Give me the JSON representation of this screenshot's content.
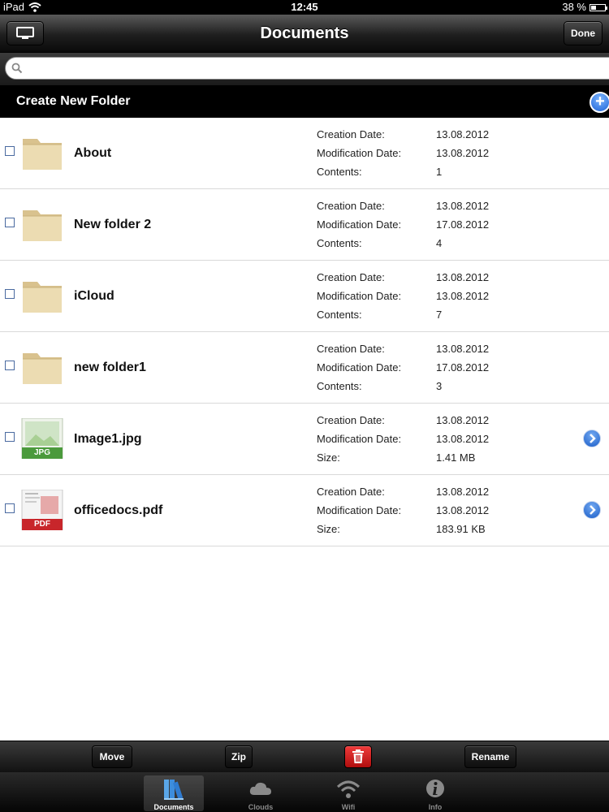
{
  "status_bar": {
    "device": "iPad",
    "time": "12:45",
    "battery": "38 %",
    "battery_level": 0.38
  },
  "nav": {
    "title": "Documents",
    "done_label": "Done"
  },
  "search": {
    "value": "",
    "placeholder": ""
  },
  "create_folder": {
    "label": "Create New Folder"
  },
  "files": [
    {
      "name": "About",
      "kind": "folder",
      "meta": [
        {
          "label": "Creation Date:",
          "value": "13.08.2012"
        },
        {
          "label": "Modification Date:",
          "value": "13.08.2012"
        },
        {
          "label": "Contents:",
          "value": "1"
        }
      ]
    },
    {
      "name": "New folder 2",
      "kind": "folder",
      "meta": [
        {
          "label": "Creation Date:",
          "value": "13.08.2012"
        },
        {
          "label": "Modification Date:",
          "value": "17.08.2012"
        },
        {
          "label": "Contents:",
          "value": "4"
        }
      ]
    },
    {
      "name": "iCloud",
      "kind": "folder",
      "meta": [
        {
          "label": "Creation Date:",
          "value": "13.08.2012"
        },
        {
          "label": "Modification Date:",
          "value": "13.08.2012"
        },
        {
          "label": "Contents:",
          "value": "7"
        }
      ]
    },
    {
      "name": "new folder1",
      "kind": "folder",
      "meta": [
        {
          "label": "Creation Date:",
          "value": "13.08.2012"
        },
        {
          "label": "Modification Date:",
          "value": "17.08.2012"
        },
        {
          "label": "Contents:",
          "value": "3"
        }
      ]
    },
    {
      "name": "Image1.jpg",
      "kind": "jpg",
      "badge": "JPG",
      "meta": [
        {
          "label": "Creation Date:",
          "value": "13.08.2012"
        },
        {
          "label": "Modification Date:",
          "value": "13.08.2012"
        },
        {
          "label": "Size:",
          "value": "1.41 MB"
        }
      ]
    },
    {
      "name": "officedocs.pdf",
      "kind": "pdf",
      "badge": "PDF",
      "meta": [
        {
          "label": "Creation Date:",
          "value": "13.08.2012"
        },
        {
          "label": "Modification Date:",
          "value": "13.08.2012"
        },
        {
          "label": "Size:",
          "value": "183.91 KB"
        }
      ]
    }
  ],
  "actions": {
    "move": "Move",
    "zip": "Zip",
    "rename": "Rename"
  },
  "tabs": [
    {
      "label": "Documents",
      "icon": "documents-icon",
      "active": true
    },
    {
      "label": "Clouds",
      "icon": "cloud-icon",
      "active": false
    },
    {
      "label": "Wifi",
      "icon": "wifi-icon",
      "active": false
    },
    {
      "label": "Info",
      "icon": "info-icon",
      "active": false
    }
  ],
  "colors": {
    "accent_blue": "#1f64d6",
    "trash_red": "#d21818",
    "folder_tan": "#e6d3a3"
  }
}
